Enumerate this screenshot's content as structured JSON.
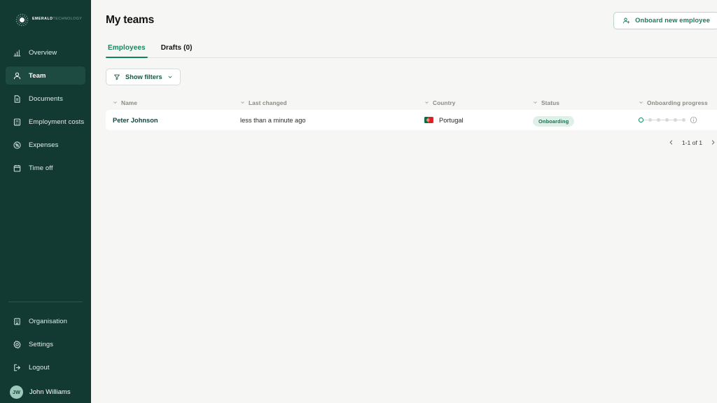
{
  "brand": {
    "name_bold": "EMERALD",
    "name_light": "TECHNOLOGY",
    "logo_icon": "emerald-circle-logo",
    "sidebar_bg": "#123a33",
    "accent": "#12855f"
  },
  "sidebar": {
    "items": [
      {
        "label": "Overview",
        "icon": "bar-chart-icon",
        "active": false
      },
      {
        "label": "Team",
        "icon": "user-icon",
        "active": true
      },
      {
        "label": "Documents",
        "icon": "document-icon",
        "active": false
      },
      {
        "label": "Employment costs",
        "icon": "calculator-icon",
        "active": false
      },
      {
        "label": "Expenses",
        "icon": "receipt-percent-icon",
        "active": false
      },
      {
        "label": "Time off",
        "icon": "calendar-icon",
        "active": false
      }
    ],
    "bottom_items": [
      {
        "label": "Organisation",
        "icon": "building-icon"
      },
      {
        "label": "Settings",
        "icon": "gear-icon"
      },
      {
        "label": "Logout",
        "icon": "logout-icon"
      }
    ],
    "user": {
      "name": "John Williams",
      "initials": "JW"
    }
  },
  "header": {
    "title": "My teams",
    "onboard_button": {
      "label": "Onboard new employee",
      "icon": "user-plus-icon"
    }
  },
  "tabs": [
    {
      "label": "Employees",
      "active": true
    },
    {
      "label": "Drafts (0)",
      "active": false
    }
  ],
  "filters": {
    "button_label": "Show filters",
    "icon": "funnel-icon",
    "chevron": "chevron-down-icon"
  },
  "table": {
    "columns": [
      {
        "label": "Name"
      },
      {
        "label": "Last changed"
      },
      {
        "label": "Country"
      },
      {
        "label": "Status"
      },
      {
        "label": "Onboarding progress"
      }
    ],
    "rows": [
      {
        "name": "Peter Johnson",
        "last_changed": "less than a minute ago",
        "country": "Portugal",
        "country_flag": "portugal-flag",
        "status": "Onboarding",
        "progress_steps_total": 6,
        "progress_steps_done": 1,
        "progress_info_icon": "info-icon"
      }
    ]
  },
  "pagination": {
    "range_text": "1-1 of 1",
    "prev_icon": "chevron-left-icon",
    "next_icon": "chevron-right-icon"
  }
}
